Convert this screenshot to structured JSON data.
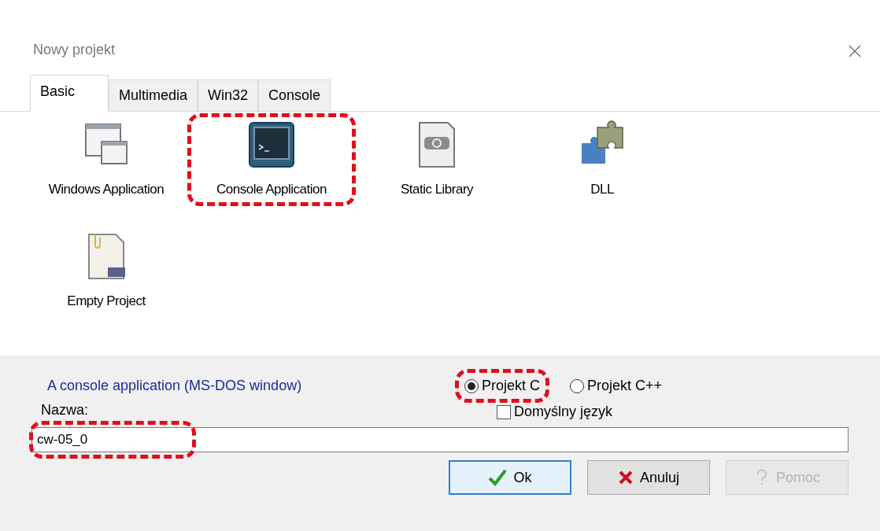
{
  "window": {
    "title": "Nowy projekt"
  },
  "tabs": [
    {
      "label": "Basic",
      "selected": true
    },
    {
      "label": "Multimedia",
      "selected": false
    },
    {
      "label": "Win32",
      "selected": false
    },
    {
      "label": "Console",
      "selected": false
    }
  ],
  "templates": [
    {
      "kind": "window",
      "label": "Windows Application",
      "highlighted": false
    },
    {
      "kind": "chip",
      "label": "Console Application",
      "highlighted": true
    },
    {
      "kind": "library",
      "label": "Static Library",
      "highlighted": false
    },
    {
      "kind": "puzzle",
      "label": "DLL",
      "highlighted": false
    },
    {
      "kind": "document",
      "label": "Empty Project",
      "highlighted": false
    }
  ],
  "description": "A console application (MS-DOS window)",
  "languages": [
    {
      "label": "Projekt C",
      "selected": true,
      "highlighted": true
    },
    {
      "label": "Projekt C++",
      "selected": false,
      "highlighted": false
    }
  ],
  "default_language": {
    "label": "Domyślny język",
    "checked": false
  },
  "name_field": {
    "label": "Nazwa:",
    "value": "cw-05_0",
    "highlighted": true
  },
  "buttons": [
    {
      "kind": "ok",
      "label": "Ok",
      "disabled": false,
      "focused": true
    },
    {
      "kind": "cancel",
      "label": "Anuluj",
      "disabled": false,
      "focused": false
    },
    {
      "kind": "help",
      "label": "Pomoc",
      "disabled": true,
      "focused": false
    }
  ]
}
